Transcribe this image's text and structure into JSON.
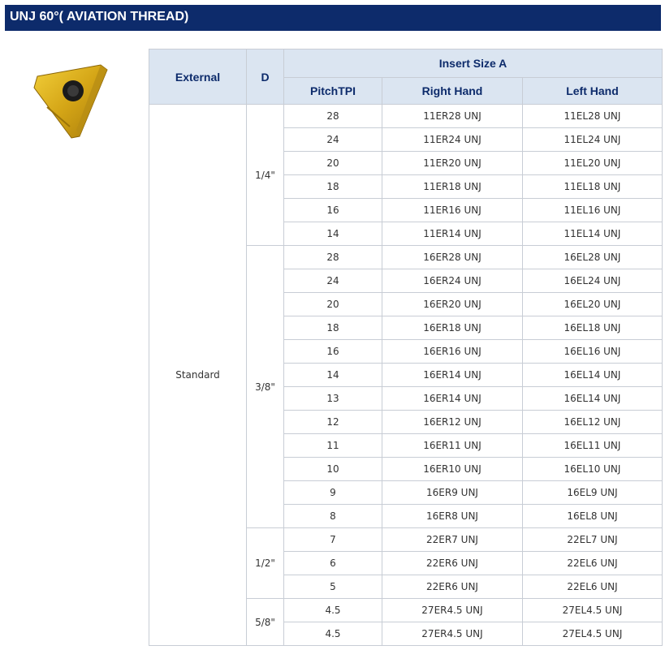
{
  "title": "UNJ 60°( AVIATION THREAD)",
  "headers": {
    "external": "External",
    "d": "D",
    "insert_size": "Insert Size A",
    "pitch": "PitchTPI",
    "right": "Right Hand",
    "left": "Left Hand"
  },
  "external_value": "Standard",
  "groups": [
    {
      "d": "1/4\"",
      "rows": [
        {
          "pitch": "28",
          "right": "11ER28 UNJ",
          "left": "11EL28 UNJ"
        },
        {
          "pitch": "24",
          "right": "11ER24 UNJ",
          "left": "11EL24 UNJ"
        },
        {
          "pitch": "20",
          "right": "11ER20 UNJ",
          "left": "11EL20 UNJ"
        },
        {
          "pitch": "18",
          "right": "11ER18 UNJ",
          "left": "11EL18 UNJ"
        },
        {
          "pitch": "16",
          "right": "11ER16 UNJ",
          "left": "11EL16 UNJ"
        },
        {
          "pitch": "14",
          "right": "11ER14 UNJ",
          "left": "11EL14 UNJ"
        }
      ]
    },
    {
      "d": "3/8\"",
      "rows": [
        {
          "pitch": "28",
          "right": "16ER28 UNJ",
          "left": "16EL28 UNJ"
        },
        {
          "pitch": "24",
          "right": "16ER24 UNJ",
          "left": "16EL24 UNJ"
        },
        {
          "pitch": "20",
          "right": "16ER20 UNJ",
          "left": "16EL20 UNJ"
        },
        {
          "pitch": "18",
          "right": "16ER18 UNJ",
          "left": "16EL18 UNJ"
        },
        {
          "pitch": "16",
          "right": "16ER16 UNJ",
          "left": "16EL16 UNJ"
        },
        {
          "pitch": "14",
          "right": "16ER14 UNJ",
          "left": "16EL14 UNJ"
        },
        {
          "pitch": "13",
          "right": "16ER14 UNJ",
          "left": "16EL14 UNJ"
        },
        {
          "pitch": "12",
          "right": "16ER12 UNJ",
          "left": "16EL12 UNJ"
        },
        {
          "pitch": "11",
          "right": "16ER11 UNJ",
          "left": "16EL11 UNJ"
        },
        {
          "pitch": "10",
          "right": "16ER10 UNJ",
          "left": "16EL10 UNJ"
        },
        {
          "pitch": "9",
          "right": "16ER9 UNJ",
          "left": "16EL9 UNJ"
        },
        {
          "pitch": "8",
          "right": "16ER8 UNJ",
          "left": "16EL8 UNJ"
        }
      ]
    },
    {
      "d": "1/2\"",
      "rows": [
        {
          "pitch": "7",
          "right": "22ER7 UNJ",
          "left": "22EL7 UNJ"
        },
        {
          "pitch": "6",
          "right": "22ER6 UNJ",
          "left": "22EL6 UNJ"
        },
        {
          "pitch": "5",
          "right": "22ER6 UNJ",
          "left": "22EL6 UNJ"
        }
      ]
    },
    {
      "d": "5/8\"",
      "rows": [
        {
          "pitch": "4.5",
          "right": "27ER4.5 UNJ",
          "left": "27EL4.5 UNJ"
        },
        {
          "pitch": "4.5",
          "right": "27ER4.5 UNJ",
          "left": "27EL4.5 UNJ"
        }
      ]
    }
  ]
}
